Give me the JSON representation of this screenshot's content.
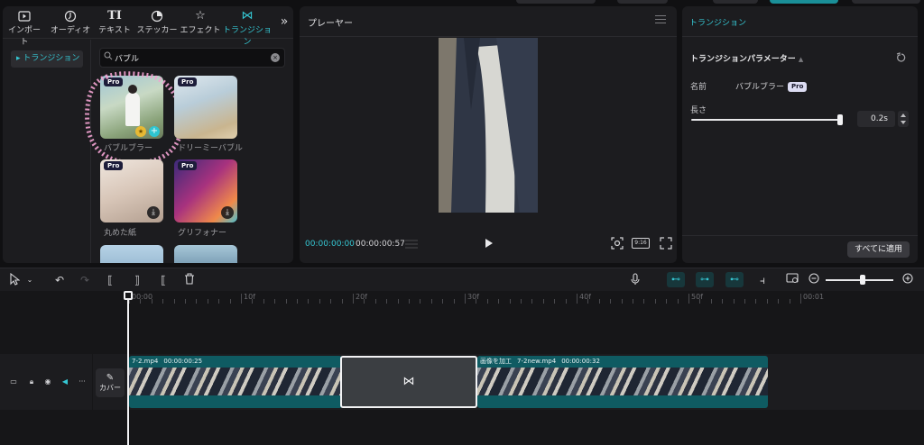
{
  "media_panel": {
    "tabs": [
      {
        "icon": "import-icon",
        "label": "インポート"
      },
      {
        "icon": "audio-icon",
        "label": "オーディオ"
      },
      {
        "icon": "text-icon",
        "label": "テキスト"
      },
      {
        "icon": "sticker-icon",
        "label": "ステッカー"
      },
      {
        "icon": "effect-icon",
        "label": "エフェクト"
      },
      {
        "icon": "transition-icon",
        "label": "トランジション"
      }
    ],
    "active_tab": "トランジション",
    "category": "トランジション",
    "search": {
      "value": "バブル",
      "placeholder": ""
    },
    "items": [
      {
        "label": "バブルブラー",
        "badge": "Pro",
        "state": "selected"
      },
      {
        "label": "ドリーミーバブル",
        "badge": "Pro",
        "state": "download"
      },
      {
        "label": "丸めた紙",
        "badge": "Pro",
        "state": "download"
      },
      {
        "label": "グリフォナー",
        "badge": "Pro",
        "state": "download"
      }
    ]
  },
  "player": {
    "title": "プレーヤー",
    "current_time": "00:00:00:00",
    "duration": "00:00:00:57",
    "ratio_label": "9:16"
  },
  "transition_panel": {
    "tab_title": "トランジション",
    "section_title": "トランジションパラメーター",
    "name_label": "名前",
    "name_value": "バブルブラー",
    "pro_badge": "Pro",
    "length_label": "長さ",
    "length_value": "0.2s",
    "length_fraction": 0.98,
    "apply_all": "すべてに適用"
  },
  "timeline": {
    "ruler_labels": [
      "00:00",
      "10f",
      "20f",
      "30f",
      "40f",
      "50f",
      "00:01"
    ],
    "cover_label": "カバー",
    "clip1": {
      "name": "7-2.mp4",
      "time": "00:00:00:25"
    },
    "clip2": {
      "edit_label": "画像を加工",
      "name": "7-2new.mp4",
      "time": "00:00:00:32"
    },
    "zoom_fraction": 0.55
  },
  "colors": {
    "accent": "#35c7d3",
    "panel": "#1c1c1f",
    "clip": "#0f5b62"
  }
}
